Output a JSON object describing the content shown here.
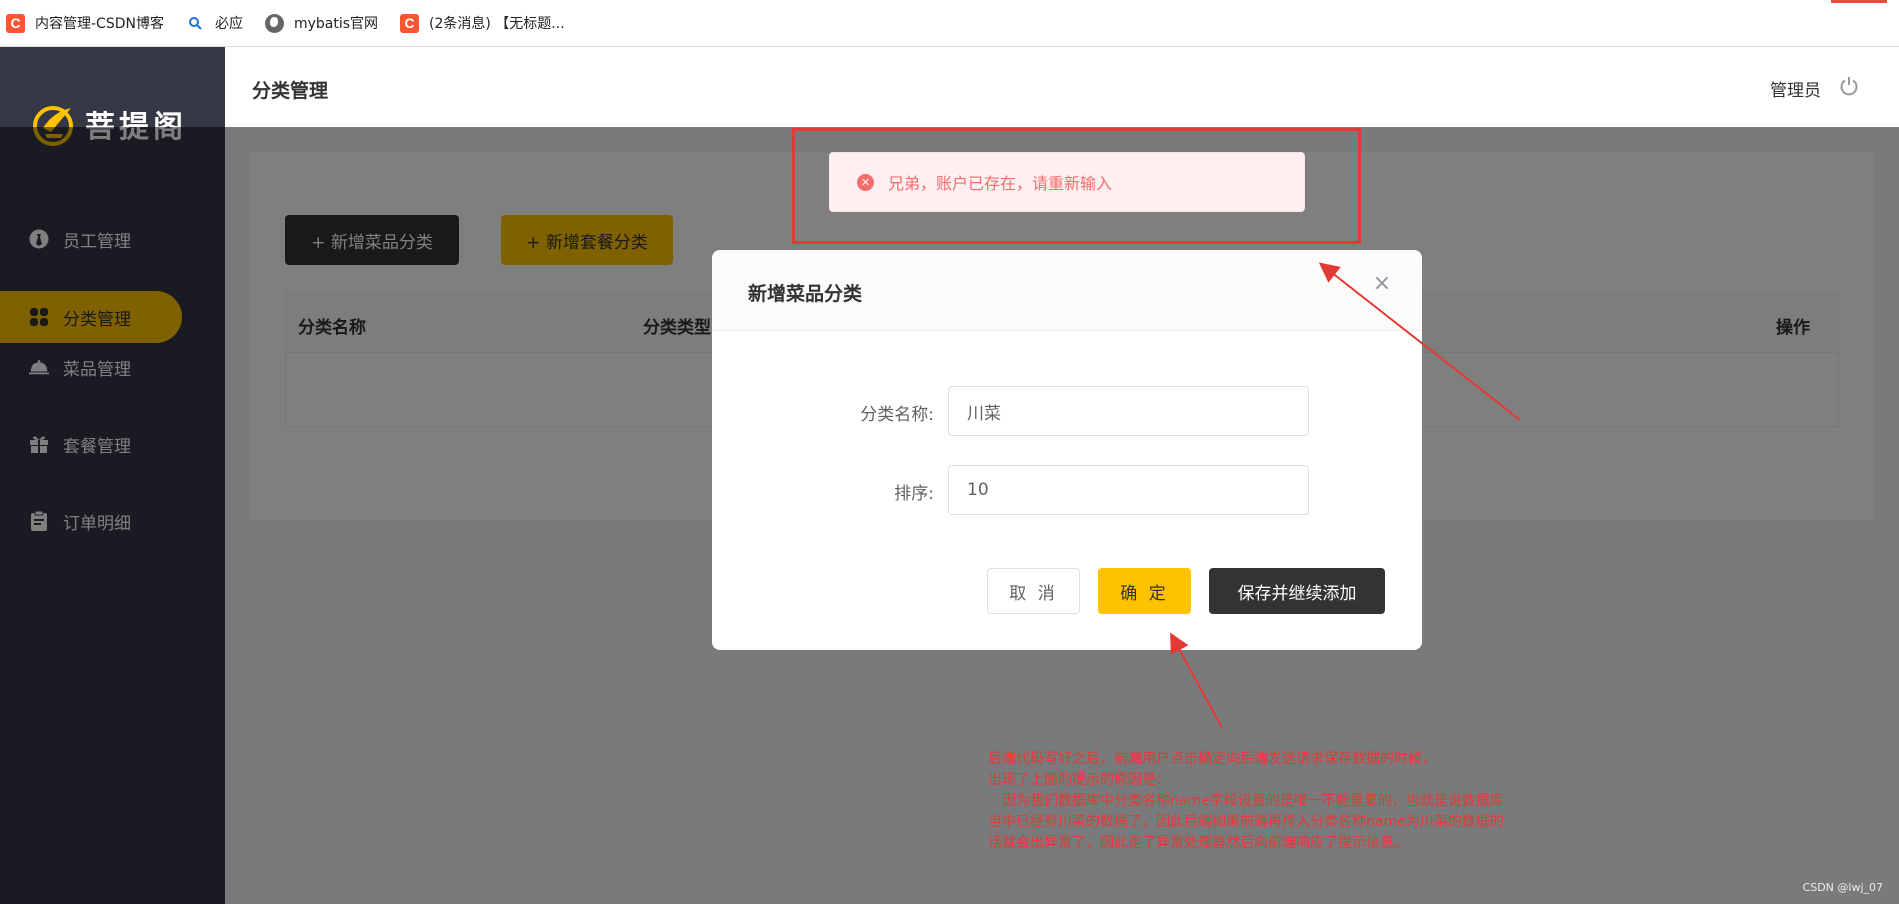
{
  "browser": {
    "bookmarks": [
      {
        "icon": "csdn-icon",
        "label": "内容管理-CSDN博客"
      },
      {
        "icon": "bing-icon",
        "label": "必应"
      },
      {
        "icon": "globe-icon",
        "label": "mybatis官网"
      },
      {
        "icon": "csdn-icon",
        "label": "(2条消息) 【无标题..."
      }
    ]
  },
  "sidebar": {
    "logo_text": "菩提阁",
    "items": [
      {
        "label": "员工管理",
        "icon": "person-icon",
        "active": false
      },
      {
        "label": "分类管理",
        "icon": "grid-icon",
        "active": true
      },
      {
        "label": "菜品管理",
        "icon": "dish-bell-icon",
        "active": false
      },
      {
        "label": "套餐管理",
        "icon": "gift-icon",
        "active": false
      },
      {
        "label": "订单明细",
        "icon": "clipboard-icon",
        "active": false
      }
    ],
    "active_color": "#ffc200"
  },
  "header": {
    "title": "分类管理",
    "user": "管理员"
  },
  "main": {
    "add_dish_category": "+ 新增菜品分类",
    "add_set_category": "+ 新增套餐分类",
    "table_headers": [
      "分类名称",
      "分类类型",
      "操作"
    ]
  },
  "dialog": {
    "title": "新增菜品分类",
    "name_label": "分类名称:",
    "name_value": "川菜",
    "sort_label": "排序:",
    "sort_value": "10",
    "cancel": "取 消",
    "confirm": "确 定",
    "save_continue": "保存并继续添加"
  },
  "message": {
    "type": "error",
    "text": "兄弟，账户已存在，请重新输入"
  },
  "annotation": {
    "lines": [
      "后端代码写好之后，前端用户点击确定向后端发送请求保存数据的时候，",
      "出现了上面的提示的原因是：",
      "　因为我们数据库中分类名称name字段设置的是唯一不能重复的，也就是说数据库",
      "当中已经有川菜的数据了，因此后端如果前端再传入分类名称name为川菜的数据的",
      "话就会出异常了，因此走了异常处理器然后向前端响应了提示信息。"
    ],
    "color": "#e53935"
  },
  "watermark": "CSDN @lwj_07"
}
